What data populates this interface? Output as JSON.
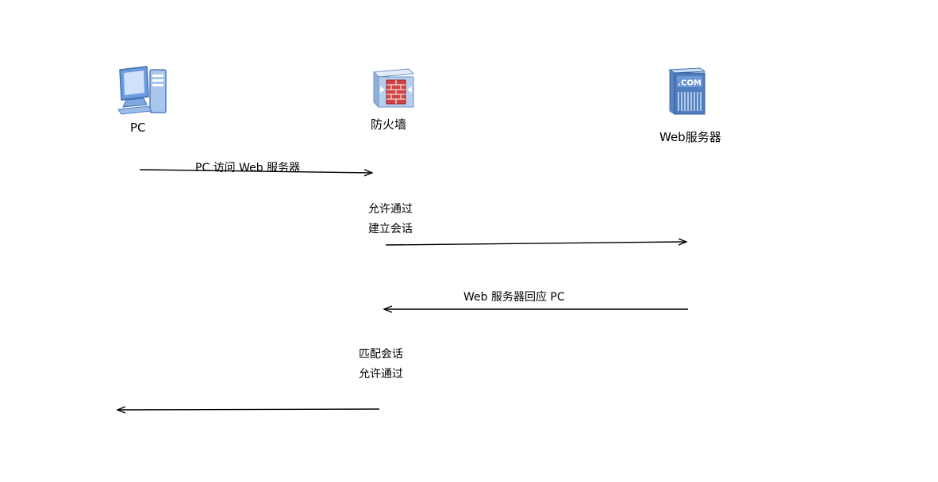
{
  "nodes": {
    "pc": {
      "label": "PC",
      "icon": "desktop-computer-icon"
    },
    "firewall": {
      "label": "防火墙",
      "icon": "firewall-icon"
    },
    "server": {
      "label": "Web服务器",
      "icon": "web-server-icon",
      "icon_text": ".COM"
    }
  },
  "messages": {
    "m1": {
      "label": "PC 访问 Web 服务器",
      "from": "pc",
      "to": "firewall"
    },
    "m2": {
      "from": "firewall",
      "to": "server"
    },
    "m3": {
      "label": "Web 服务器回应 PC",
      "from": "server",
      "to": "firewall"
    },
    "m4": {
      "from": "firewall",
      "to": "pc"
    }
  },
  "notes": {
    "firewall_first": {
      "line1": "允许通过",
      "line2": "建立会话"
    },
    "firewall_second": {
      "line1": "匹配会话",
      "line2": "允许通过"
    }
  },
  "colors": {
    "icon_blue": "#5b8fd6",
    "icon_light": "#c8dcf4",
    "firewall_red": "#c63b3b",
    "line": "#000000"
  }
}
